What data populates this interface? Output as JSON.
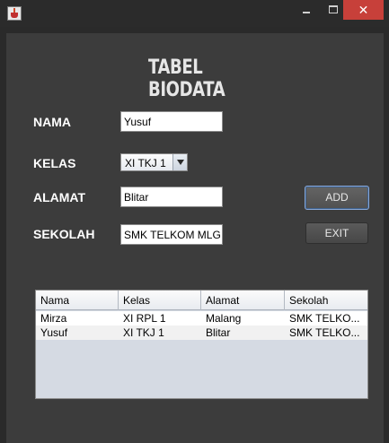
{
  "window": {
    "title": ""
  },
  "heading": "TABEL BIODATA",
  "form": {
    "nama_label": "NAMA",
    "nama_value": "Yusuf",
    "kelas_label": "KELAS",
    "kelas_value": "XI TKJ 1",
    "alamat_label": "ALAMAT",
    "alamat_value": "Blitar",
    "sekolah_label": "SEKOLAH",
    "sekolah_value": "SMK TELKOM MLG"
  },
  "buttons": {
    "add": "ADD",
    "exit": "EXIT"
  },
  "table": {
    "headers": [
      "Nama",
      "Kelas",
      "Alamat",
      "Sekolah"
    ],
    "rows": [
      [
        "Mirza",
        "XI RPL 1",
        "Malang",
        "SMK TELKO..."
      ],
      [
        "Yusuf",
        "XI TKJ 1",
        "Blitar",
        "SMK TELKO..."
      ]
    ]
  },
  "icons": {
    "app": "java-app-icon",
    "minimize": "minimize-icon",
    "maximize": "maximize-icon",
    "close": "close-icon",
    "dropdown": "chevron-down-icon"
  },
  "colors": {
    "background": "#3c3c3c",
    "titlebar": "#2b2b2b",
    "close_button": "#c7403a",
    "button_focus_border": "#8aa9d8"
  }
}
